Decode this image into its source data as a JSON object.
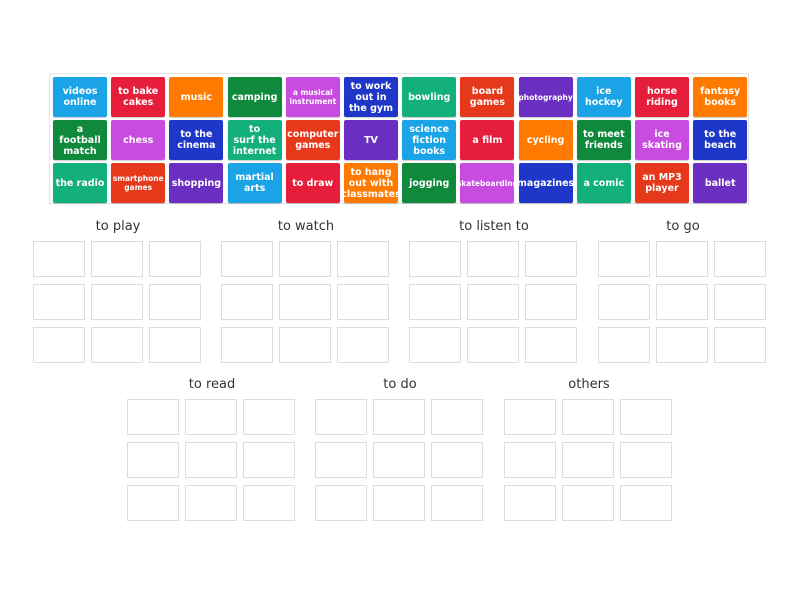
{
  "bank": {
    "rows": [
      [
        {
          "label": "videos\nonline",
          "color": "#1aa3e6"
        },
        {
          "label": "to bake\ncakes",
          "color": "#e61e3c"
        },
        {
          "label": "music",
          "color": "#ff7a00"
        },
        {
          "label": "camping",
          "color": "#0f8a3c"
        },
        {
          "label": "a musical\ninstrument",
          "color": "#c84ce0",
          "small": true
        },
        {
          "label": "to work\nout in\nthe gym",
          "color": "#1f37c8"
        },
        {
          "label": "bowling",
          "color": "#14b07a"
        },
        {
          "label": "board\ngames",
          "color": "#e6381a"
        },
        {
          "label": "photography",
          "color": "#6a2fc0",
          "small": true
        },
        {
          "label": "ice\nhockey",
          "color": "#1aa3e6"
        },
        {
          "label": "horse\nriding",
          "color": "#e61e3c"
        },
        {
          "label": "fantasy\nbooks",
          "color": "#ff7a00"
        }
      ],
      [
        {
          "label": "a football\nmatch",
          "color": "#0f8a3c"
        },
        {
          "label": "chess",
          "color": "#c84ce0"
        },
        {
          "label": "to the\ncinema",
          "color": "#1f37c8"
        },
        {
          "label": "to\nsurf the\ninternet",
          "color": "#14b07a"
        },
        {
          "label": "computer\ngames",
          "color": "#e6381a"
        },
        {
          "label": "TV",
          "color": "#6a2fc0"
        },
        {
          "label": "science\nfiction\nbooks",
          "color": "#1aa3e6"
        },
        {
          "label": "a film",
          "color": "#e61e3c"
        },
        {
          "label": "cycling",
          "color": "#ff7a00"
        },
        {
          "label": "to meet\nfriends",
          "color": "#0f8a3c"
        },
        {
          "label": "ice\nskating",
          "color": "#c84ce0"
        },
        {
          "label": "to the\nbeach",
          "color": "#1f37c8"
        }
      ],
      [
        {
          "label": "the radio",
          "color": "#14b07a"
        },
        {
          "label": "smartphone\ngames",
          "color": "#e6381a",
          "small": true
        },
        {
          "label": "shopping",
          "color": "#6a2fc0"
        },
        {
          "label": "martial\narts",
          "color": "#1aa3e6"
        },
        {
          "label": "to draw",
          "color": "#e61e3c"
        },
        {
          "label": "to hang\nout with\nclassmates",
          "color": "#ff7a00"
        },
        {
          "label": "jogging",
          "color": "#0f8a3c"
        },
        {
          "label": "skateboarding",
          "color": "#c84ce0",
          "small": true
        },
        {
          "label": "magazines",
          "color": "#1f37c8"
        },
        {
          "label": "a comic",
          "color": "#14b07a"
        },
        {
          "label": "an MP3\nplayer",
          "color": "#e6381a"
        },
        {
          "label": "ballet",
          "color": "#6a2fc0"
        }
      ]
    ]
  },
  "groups": [
    {
      "title": "to play"
    },
    {
      "title": "to watch"
    },
    {
      "title": "to listen to"
    },
    {
      "title": "to go"
    },
    {
      "title": "to read"
    },
    {
      "title": "to do"
    },
    {
      "title": "others"
    }
  ]
}
